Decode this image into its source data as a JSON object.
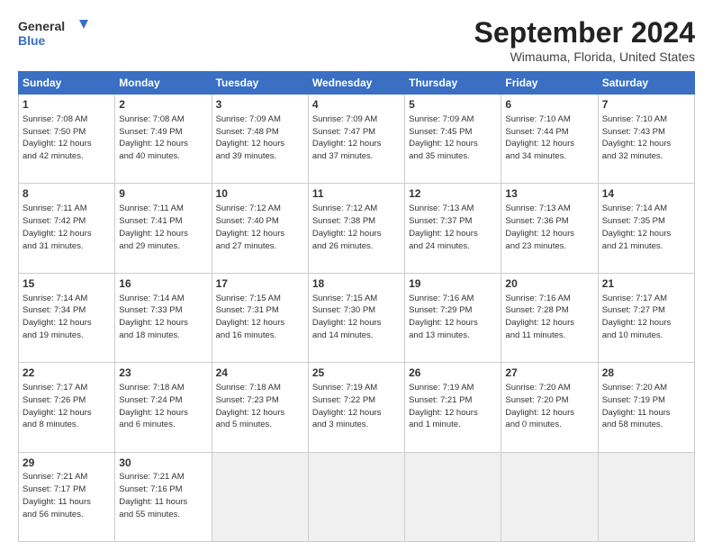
{
  "header": {
    "logo_line1": "General",
    "logo_line2": "Blue",
    "month": "September 2024",
    "location": "Wimauma, Florida, United States"
  },
  "weekdays": [
    "Sunday",
    "Monday",
    "Tuesday",
    "Wednesday",
    "Thursday",
    "Friday",
    "Saturday"
  ],
  "weeks": [
    [
      {
        "day": "1",
        "info": "Sunrise: 7:08 AM\nSunset: 7:50 PM\nDaylight: 12 hours\nand 42 minutes."
      },
      {
        "day": "2",
        "info": "Sunrise: 7:08 AM\nSunset: 7:49 PM\nDaylight: 12 hours\nand 40 minutes."
      },
      {
        "day": "3",
        "info": "Sunrise: 7:09 AM\nSunset: 7:48 PM\nDaylight: 12 hours\nand 39 minutes."
      },
      {
        "day": "4",
        "info": "Sunrise: 7:09 AM\nSunset: 7:47 PM\nDaylight: 12 hours\nand 37 minutes."
      },
      {
        "day": "5",
        "info": "Sunrise: 7:09 AM\nSunset: 7:45 PM\nDaylight: 12 hours\nand 35 minutes."
      },
      {
        "day": "6",
        "info": "Sunrise: 7:10 AM\nSunset: 7:44 PM\nDaylight: 12 hours\nand 34 minutes."
      },
      {
        "day": "7",
        "info": "Sunrise: 7:10 AM\nSunset: 7:43 PM\nDaylight: 12 hours\nand 32 minutes."
      }
    ],
    [
      {
        "day": "8",
        "info": "Sunrise: 7:11 AM\nSunset: 7:42 PM\nDaylight: 12 hours\nand 31 minutes."
      },
      {
        "day": "9",
        "info": "Sunrise: 7:11 AM\nSunset: 7:41 PM\nDaylight: 12 hours\nand 29 minutes."
      },
      {
        "day": "10",
        "info": "Sunrise: 7:12 AM\nSunset: 7:40 PM\nDaylight: 12 hours\nand 27 minutes."
      },
      {
        "day": "11",
        "info": "Sunrise: 7:12 AM\nSunset: 7:38 PM\nDaylight: 12 hours\nand 26 minutes."
      },
      {
        "day": "12",
        "info": "Sunrise: 7:13 AM\nSunset: 7:37 PM\nDaylight: 12 hours\nand 24 minutes."
      },
      {
        "day": "13",
        "info": "Sunrise: 7:13 AM\nSunset: 7:36 PM\nDaylight: 12 hours\nand 23 minutes."
      },
      {
        "day": "14",
        "info": "Sunrise: 7:14 AM\nSunset: 7:35 PM\nDaylight: 12 hours\nand 21 minutes."
      }
    ],
    [
      {
        "day": "15",
        "info": "Sunrise: 7:14 AM\nSunset: 7:34 PM\nDaylight: 12 hours\nand 19 minutes."
      },
      {
        "day": "16",
        "info": "Sunrise: 7:14 AM\nSunset: 7:33 PM\nDaylight: 12 hours\nand 18 minutes."
      },
      {
        "day": "17",
        "info": "Sunrise: 7:15 AM\nSunset: 7:31 PM\nDaylight: 12 hours\nand 16 minutes."
      },
      {
        "day": "18",
        "info": "Sunrise: 7:15 AM\nSunset: 7:30 PM\nDaylight: 12 hours\nand 14 minutes."
      },
      {
        "day": "19",
        "info": "Sunrise: 7:16 AM\nSunset: 7:29 PM\nDaylight: 12 hours\nand 13 minutes."
      },
      {
        "day": "20",
        "info": "Sunrise: 7:16 AM\nSunset: 7:28 PM\nDaylight: 12 hours\nand 11 minutes."
      },
      {
        "day": "21",
        "info": "Sunrise: 7:17 AM\nSunset: 7:27 PM\nDaylight: 12 hours\nand 10 minutes."
      }
    ],
    [
      {
        "day": "22",
        "info": "Sunrise: 7:17 AM\nSunset: 7:26 PM\nDaylight: 12 hours\nand 8 minutes."
      },
      {
        "day": "23",
        "info": "Sunrise: 7:18 AM\nSunset: 7:24 PM\nDaylight: 12 hours\nand 6 minutes."
      },
      {
        "day": "24",
        "info": "Sunrise: 7:18 AM\nSunset: 7:23 PM\nDaylight: 12 hours\nand 5 minutes."
      },
      {
        "day": "25",
        "info": "Sunrise: 7:19 AM\nSunset: 7:22 PM\nDaylight: 12 hours\nand 3 minutes."
      },
      {
        "day": "26",
        "info": "Sunrise: 7:19 AM\nSunset: 7:21 PM\nDaylight: 12 hours\nand 1 minute."
      },
      {
        "day": "27",
        "info": "Sunrise: 7:20 AM\nSunset: 7:20 PM\nDaylight: 12 hours\nand 0 minutes."
      },
      {
        "day": "28",
        "info": "Sunrise: 7:20 AM\nSunset: 7:19 PM\nDaylight: 11 hours\nand 58 minutes."
      }
    ],
    [
      {
        "day": "29",
        "info": "Sunrise: 7:21 AM\nSunset: 7:17 PM\nDaylight: 11 hours\nand 56 minutes."
      },
      {
        "day": "30",
        "info": "Sunrise: 7:21 AM\nSunset: 7:16 PM\nDaylight: 11 hours\nand 55 minutes."
      },
      {
        "day": "",
        "info": ""
      },
      {
        "day": "",
        "info": ""
      },
      {
        "day": "",
        "info": ""
      },
      {
        "day": "",
        "info": ""
      },
      {
        "day": "",
        "info": ""
      }
    ]
  ]
}
